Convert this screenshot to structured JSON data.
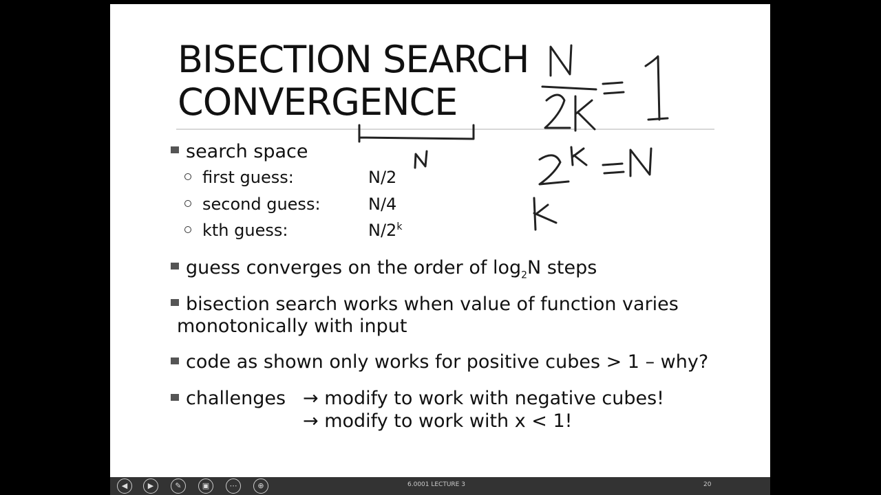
{
  "slide": {
    "title_line1": "BISECTION SEARCH",
    "title_line2": "CONVERGENCE",
    "bullets": {
      "search_space": "search space",
      "guesses": [
        {
          "label": "first guess:",
          "value": "N/2",
          "sup": ""
        },
        {
          "label": "second guess:",
          "value": "N/4",
          "sup": ""
        },
        {
          "label": "kth guess:",
          "value": "N/2",
          "sup": "k"
        }
      ],
      "converges_pre": "guess converges on the order of log",
      "converges_sub": "2",
      "converges_post": "N steps",
      "bisection_line1": "bisection search works when value of function varies",
      "bisection_line2": "monotonically with input",
      "code_line": "code as shown only works for positive cubes > 1 – why?",
      "challenges_label": "challenges",
      "challenge1": "→ modify to work with negative cubes!",
      "challenge2": "→ modify to work with x < 1!"
    },
    "handwriting": {
      "n_near_guess": "N",
      "eq1_num": "N",
      "eq1_den": "2k",
      "eq1_rhs": "= 1",
      "eq2": "2k = N",
      "k": "k"
    }
  },
  "controls": {
    "footer_label": "6.0001 LECTURE 3",
    "page_number": "20",
    "buttons": [
      "previous-icon",
      "next-icon",
      "pen-icon",
      "highlighter-icon",
      "more-icon",
      "zoom-icon"
    ]
  }
}
